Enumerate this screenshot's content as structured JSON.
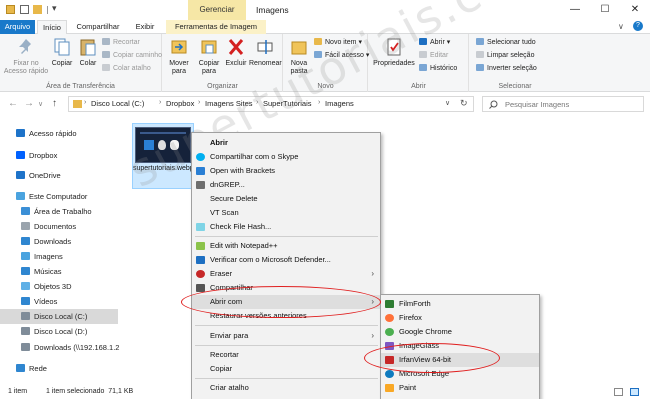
{
  "titlebar": {
    "context_group": "Gerenciar",
    "window_title": "Imagens",
    "minimize": "—",
    "maximize": "☐",
    "close": "✕"
  },
  "tabs": [
    "Arquivo",
    "Início",
    "Compartilhar",
    "Exibir",
    "Ferramentas de Imagem"
  ],
  "ribbon": {
    "clipboard": {
      "pin": "Fixar no Acesso rápido",
      "copy": "Copiar",
      "paste": "Colar",
      "cut": "Recortar",
      "copy_path": "Copiar caminho",
      "paste_shortcut": "Colar atalho",
      "label": "Área de Transferência"
    },
    "organize": {
      "move": "Mover para",
      "copy_to": "Copiar para",
      "delete": "Excluir",
      "rename": "Renomear",
      "label": "Organizar"
    },
    "new": {
      "new_folder": "Nova pasta",
      "new_item": "Novo item ▾",
      "easy_access": "Fácil acesso ▾",
      "label": "Novo"
    },
    "open": {
      "properties": "Propriedades",
      "open": "Abrir ▾",
      "edit": "Editar",
      "history": "Histórico",
      "label": "Abrir"
    },
    "select": {
      "select_all": "Selecionar tudo",
      "select_none": "Limpar seleção",
      "invert": "Inverter seleção",
      "label": "Selecionar"
    }
  },
  "address": {
    "back": "←",
    "forward": "→",
    "recent": "∨",
    "up": "↑",
    "crumbs": [
      "Disco Local (C:)",
      "Dropbox",
      "Imagens Sites",
      "SuperTutoriais",
      "Imagens"
    ],
    "search_placeholder": "Pesquisar Imagens"
  },
  "nav": {
    "items": [
      {
        "label": "Acesso rápido",
        "icon": "star-icon",
        "color": "#1e73c9"
      },
      {
        "label": "Dropbox",
        "icon": "dropbox-icon",
        "color": "#0061fe"
      },
      {
        "label": "OneDrive",
        "icon": "cloud-icon",
        "color": "#1e73c9"
      },
      {
        "label": "Este Computador",
        "icon": "computer-icon",
        "color": "#4aa3df"
      },
      {
        "label": "Área de Trabalho",
        "icon": "desktop-icon",
        "color": "#3b8fd6"
      },
      {
        "label": "Documentos",
        "icon": "documents-icon",
        "color": "#9aa4ad"
      },
      {
        "label": "Downloads",
        "icon": "downloads-icon",
        "color": "#2f86d0"
      },
      {
        "label": "Imagens",
        "icon": "pictures-icon",
        "color": "#4aa3df"
      },
      {
        "label": "Músicas",
        "icon": "music-icon",
        "color": "#2f86d0"
      },
      {
        "label": "Objetos 3D",
        "icon": "objects-3d-icon",
        "color": "#5fb0e6"
      },
      {
        "label": "Vídeos",
        "icon": "videos-icon",
        "color": "#2f86d0"
      },
      {
        "label": "Disco Local (C:)",
        "icon": "drive-icon",
        "color": "#7f8c99"
      },
      {
        "label": "Disco Local (D:)",
        "icon": "drive-icon",
        "color": "#7f8c99"
      },
      {
        "label": "Downloads (\\\\192.168.1.2",
        "icon": "network-drive-icon",
        "color": "#7f8c99"
      },
      {
        "label": "Rede",
        "icon": "network-icon",
        "color": "#2f86d0"
      }
    ]
  },
  "file": {
    "name": "supertutoriais.webp"
  },
  "context_menu": {
    "items": [
      "Abrir",
      "Compartilhar com o Skype",
      "Open with Brackets",
      "dnGREP...",
      "Secure Delete",
      "VT Scan",
      "Check File Hash...",
      "Edit with Notepad++",
      "Verificar com o Microsoft Defender...",
      "Eraser",
      "Compartilhar",
      "Abrir com",
      "Restaurar versões anteriores",
      "Enviar para",
      "Recortar",
      "Copiar",
      "Criar atalho"
    ]
  },
  "submenu": {
    "items": [
      "FilmForth",
      "Firefox",
      "Google Chrome",
      "ImageGlass",
      "IrfanView 64-bit",
      "Microsoft Edge",
      "Paint"
    ]
  },
  "status": {
    "count": "1 item",
    "selected": "1 item selecionado  71,1 KB"
  },
  "watermark": "supertutoriais.com.br"
}
